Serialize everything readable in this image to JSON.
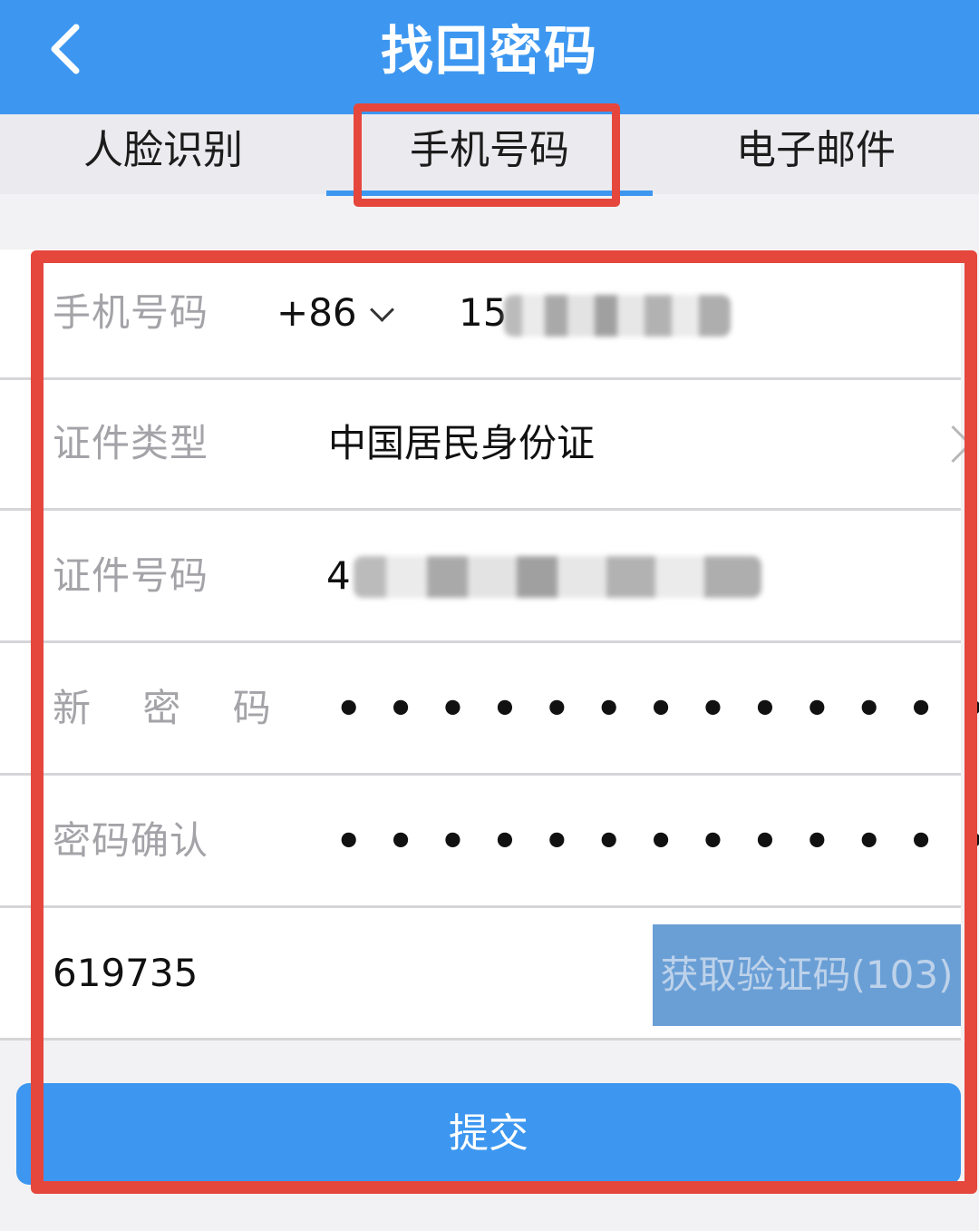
{
  "header": {
    "title": "找回密码",
    "back_icon": "chevron-left-icon"
  },
  "tabs": [
    {
      "label": "人脸识别"
    },
    {
      "label": "手机号码",
      "active": true
    },
    {
      "label": "电子邮件"
    }
  ],
  "form": {
    "phone": {
      "label": "手机号码",
      "country_code": "+86",
      "value_visible": "15"
    },
    "id_type": {
      "label": "证件类型",
      "value": "中国居民身份证"
    },
    "id_number": {
      "label": "证件号码",
      "value_visible": "4"
    },
    "new_password": {
      "label": "新 密 码",
      "value": "•••••••••••••"
    },
    "confirm_password": {
      "label": "密码确认",
      "value": "•••••••••••••"
    },
    "verification": {
      "value": "619735",
      "button_label": "获取验证码(103)"
    }
  },
  "submit_label": "提交",
  "colors": {
    "primary": "#3d97f0",
    "annotation": "#e5473d",
    "code_button": "#6a9fd6",
    "label_gray": "#a3a3a8"
  }
}
